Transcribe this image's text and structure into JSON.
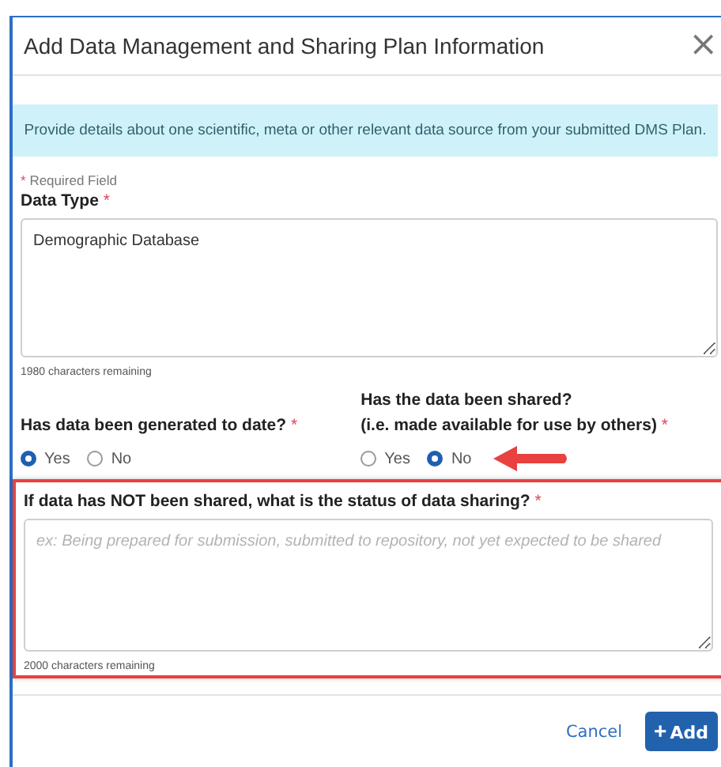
{
  "dialog": {
    "title": "Add Data Management and Sharing Plan Information",
    "close": "×"
  },
  "info": "Provide details about one scientific, meta or other relevant data source from your submitted DMS Plan.",
  "required_legend": {
    "mark": "*",
    "text": "Required Field"
  },
  "data_type": {
    "label": "Data Type",
    "mark": "*",
    "value": "Demographic Database",
    "counter": "1980 characters remaining"
  },
  "questions": [
    {
      "label": "Has data been generated to date?",
      "mark": "*",
      "options": [
        {
          "label": "Yes",
          "selected": true
        },
        {
          "label": "No",
          "selected": false
        }
      ]
    },
    {
      "label": "Has the data been shared?",
      "sublabel": "(i.e. made available for use by others)",
      "mark": "*",
      "options": [
        {
          "label": "Yes",
          "selected": false
        },
        {
          "label": "No",
          "selected": true
        }
      ]
    }
  ],
  "annotation_arrow": true,
  "status_field": {
    "label": "If data has NOT been shared, what is the status of data sharing?",
    "mark": "*",
    "placeholder": "ex: Being prepared for submission, submitted to repository, not yet expected to be shared",
    "counter": "2000 characters remaining",
    "highlighted": true
  },
  "buttons": {
    "cancel": "Cancel",
    "add_icon": "+",
    "add": "Add"
  }
}
